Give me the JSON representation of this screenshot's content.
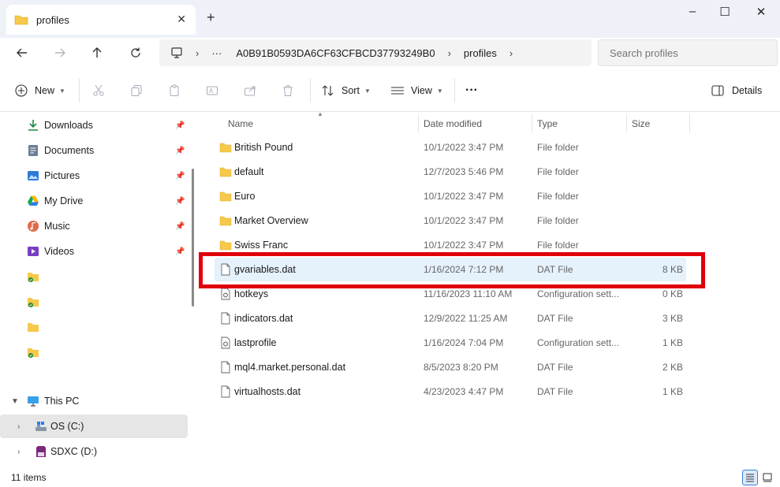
{
  "window": {
    "tab_title": "profiles",
    "new_tab": "+",
    "minimize": "–",
    "maximize": "☐",
    "close": "✕"
  },
  "address": {
    "ellipsis": "···",
    "segments": [
      "A0B91B0593DA6CF63CFBCD37793249B0",
      "profiles"
    ],
    "search_placeholder": "Search profiles"
  },
  "toolbar": {
    "new_label": "New",
    "sort_label": "Sort",
    "view_label": "View",
    "more_label": "···",
    "details_label": "Details"
  },
  "sidebar": {
    "quick_access": [
      {
        "label": "Downloads",
        "icon": "download-icon"
      },
      {
        "label": "Documents",
        "icon": "documents-icon"
      },
      {
        "label": "Pictures",
        "icon": "pictures-icon"
      },
      {
        "label": "My Drive",
        "icon": "google-drive-icon"
      },
      {
        "label": "Music",
        "icon": "music-icon"
      },
      {
        "label": "Videos",
        "icon": "videos-icon"
      }
    ],
    "this_pc": "This PC",
    "drives": [
      {
        "label": "OS (C:)"
      },
      {
        "label": "SDXC (D:)"
      }
    ]
  },
  "columns": {
    "name": "Name",
    "date": "Date modified",
    "type": "Type",
    "size": "Size"
  },
  "files": [
    {
      "name": "British Pound",
      "date": "10/1/2022 3:47 PM",
      "type": "File folder",
      "size": "",
      "kind": "folder"
    },
    {
      "name": "default",
      "date": "12/7/2023 5:46 PM",
      "type": "File folder",
      "size": "",
      "kind": "folder"
    },
    {
      "name": "Euro",
      "date": "10/1/2022 3:47 PM",
      "type": "File folder",
      "size": "",
      "kind": "folder"
    },
    {
      "name": "Market Overview",
      "date": "10/1/2022 3:47 PM",
      "type": "File folder",
      "size": "",
      "kind": "folder"
    },
    {
      "name": "Swiss Franc",
      "date": "10/1/2022 3:47 PM",
      "type": "File folder",
      "size": "",
      "kind": "folder"
    },
    {
      "name": "gvariables.dat",
      "date": "1/16/2024 7:12 PM",
      "type": "DAT File",
      "size": "8 KB",
      "kind": "file"
    },
    {
      "name": "hotkeys",
      "date": "11/16/2023 11:10 AM",
      "type": "Configuration sett...",
      "size": "0 KB",
      "kind": "config"
    },
    {
      "name": "indicators.dat",
      "date": "12/9/2022 11:25 AM",
      "type": "DAT File",
      "size": "3 KB",
      "kind": "file"
    },
    {
      "name": "lastprofile",
      "date": "1/16/2024 7:04 PM",
      "type": "Configuration sett...",
      "size": "1 KB",
      "kind": "config"
    },
    {
      "name": "mql4.market.personal.dat",
      "date": "8/5/2023 8:20 PM",
      "type": "DAT File",
      "size": "2 KB",
      "kind": "file"
    },
    {
      "name": "virtualhosts.dat",
      "date": "4/23/2023 4:47 PM",
      "type": "DAT File",
      "size": "1 KB",
      "kind": "file"
    }
  ],
  "status": {
    "item_count": "11 items"
  },
  "colors": {
    "folder": "#f7c94a",
    "highlight": "#e0000a",
    "selection": "#e5f1fb"
  }
}
